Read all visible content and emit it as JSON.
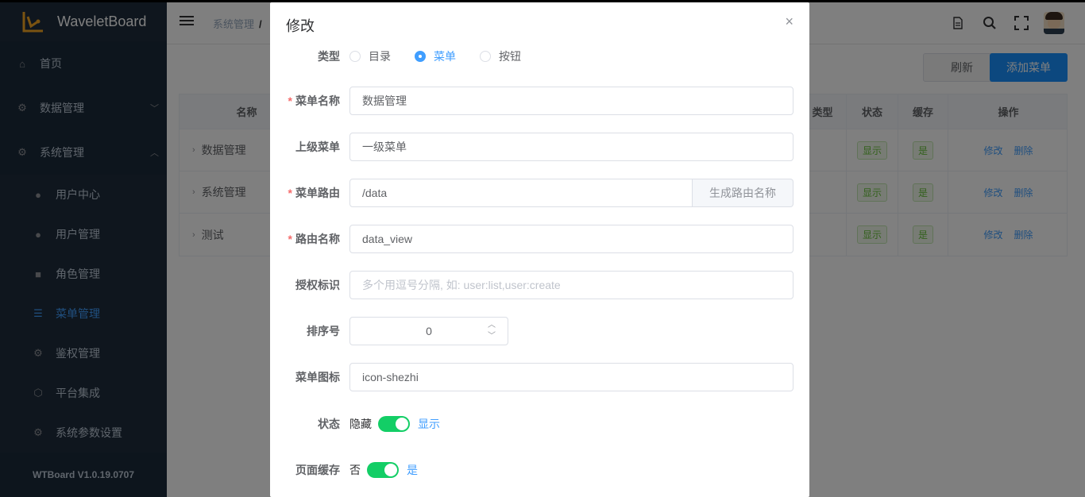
{
  "app": {
    "name": "WaveletBoard",
    "version": "WTBoard V1.0.19.0707"
  },
  "sidebar": {
    "items": [
      {
        "label": "首页",
        "icon": "home-icon"
      },
      {
        "label": "数据管理",
        "icon": "gear-icon"
      },
      {
        "label": "系统管理",
        "icon": "gear-icon"
      }
    ],
    "sub_items": [
      {
        "label": "用户中心",
        "icon": "user-icon"
      },
      {
        "label": "用户管理",
        "icon": "user-icon"
      },
      {
        "label": "角色管理",
        "icon": "lock-icon"
      },
      {
        "label": "菜单管理",
        "icon": "list-icon"
      },
      {
        "label": "鉴权管理",
        "icon": "gear-icon"
      },
      {
        "label": "平台集成",
        "icon": "cube-icon"
      },
      {
        "label": "系统参数设置",
        "icon": "gear-icon"
      }
    ]
  },
  "header": {
    "breadcrumb": "系统管理",
    "breadcrumb_sep": "/"
  },
  "toolbar": {
    "refresh_label": "刷新",
    "add_label": "添加菜单"
  },
  "table": {
    "headers": {
      "name": "名称",
      "type": "类型",
      "status": "状态",
      "cache": "缓存",
      "ops": "操作"
    },
    "rows": [
      {
        "name": "数据管理",
        "status": "显示",
        "cache": "是",
        "edit": "修改",
        "delete": "删除"
      },
      {
        "name": "系统管理",
        "status": "显示",
        "cache": "是",
        "edit": "修改",
        "delete": "删除"
      },
      {
        "name": "测试",
        "status": "显示",
        "cache": "是",
        "edit": "修改",
        "delete": "删除"
      }
    ]
  },
  "dialog": {
    "title": "修改",
    "close": "×",
    "type_label": "类型",
    "type_options": [
      "目录",
      "菜单",
      "按钮"
    ],
    "type_selected": "菜单",
    "menu_name_label": "菜单名称",
    "menu_name_value": "数据管理",
    "parent_label": "上级菜单",
    "parent_value": "一级菜单",
    "route_label": "菜单路由",
    "route_value": "/data",
    "route_button": "生成路由名称",
    "route_name_label": "路由名称",
    "route_name_value": "data_view",
    "perm_label": "授权标识",
    "perm_placeholder": "多个用逗号分隔, 如: user:list,user:create",
    "order_label": "排序号",
    "order_value": "0",
    "icon_label": "菜单图标",
    "icon_value": "icon-shezhi",
    "status_label": "状态",
    "status_off": "隐藏",
    "status_on": "显示",
    "status_enabled": true,
    "cache_label": "页面缓存",
    "cache_off": "否",
    "cache_on": "是",
    "cache_enabled": true,
    "required_mark": "*"
  }
}
